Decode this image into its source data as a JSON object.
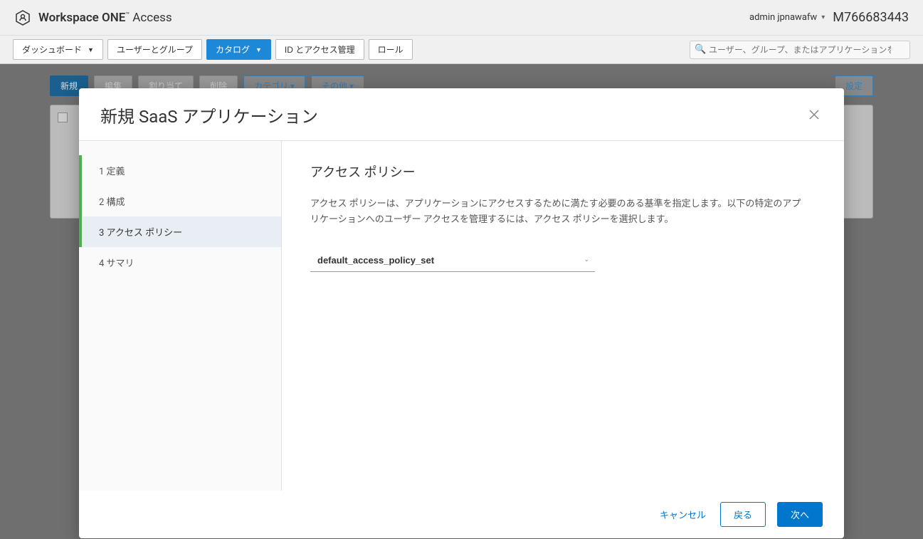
{
  "brand": {
    "name_bold": "Workspace ONE",
    "tm": "™",
    "suffix": " Access"
  },
  "header": {
    "admin_label": "admin jpnawafw",
    "tenant_id": "M766683443"
  },
  "nav": {
    "dashboard": "ダッシュボード",
    "users_groups": "ユーザーとグループ",
    "catalog": "カタログ",
    "id_access": "ID とアクセス管理",
    "roles": "ロール"
  },
  "search": {
    "placeholder": "ユーザー、グループ、またはアプリケーションを検索"
  },
  "bg_toolbar": {
    "new": "新規",
    "edit": "編集",
    "assign": "割り当て",
    "delete": "削除",
    "category": "カテゴリ ▾",
    "more": "その他 ▾",
    "settings": "設定"
  },
  "modal": {
    "title": "新規 SaaS アプリケーション",
    "steps": {
      "s1": "1 定義",
      "s2": "2 構成",
      "s3": "3 アクセス ポリシー",
      "s4": "4 サマリ"
    },
    "section_title": "アクセス ポリシー",
    "section_desc": "アクセス ポリシーは、アプリケーションにアクセスするために満たす必要のある基準を指定します。以下の特定のアプリケーションへのユーザー アクセスを管理するには、アクセス ポリシーを選択します。",
    "policy_value": "default_access_policy_set",
    "footer": {
      "cancel": "キャンセル",
      "back": "戻る",
      "next": "次へ"
    }
  }
}
